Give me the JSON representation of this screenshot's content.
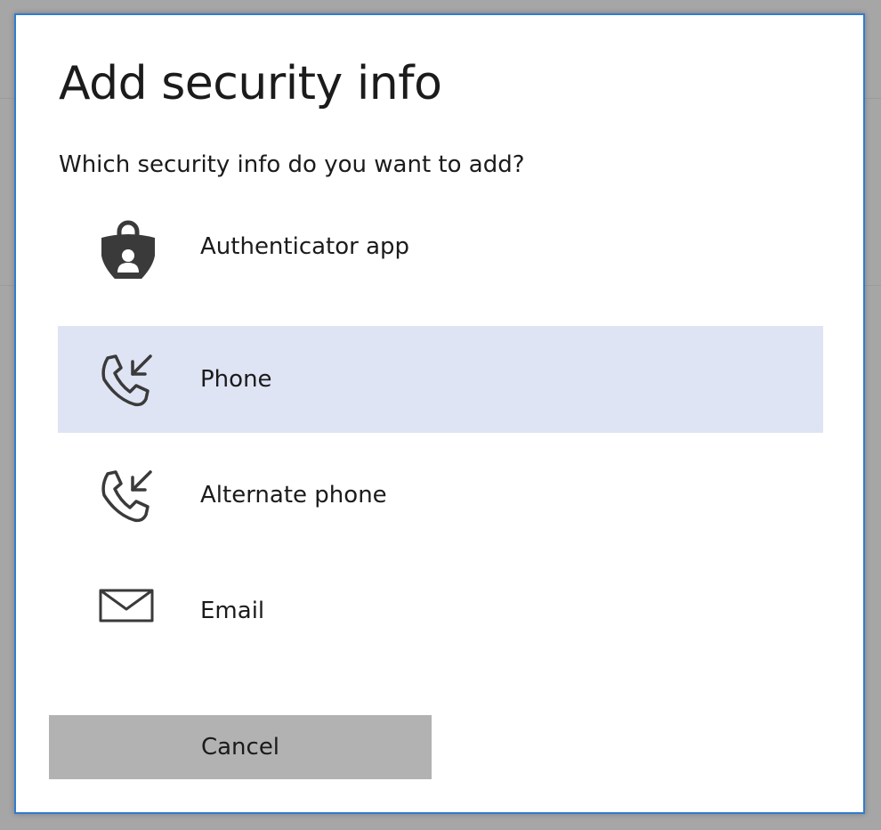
{
  "dialog": {
    "title": "Add security info",
    "prompt": "Which security info do you want to add?",
    "options": [
      {
        "label": "Authenticator app",
        "icon": "authenticator-shield-icon",
        "selected": false
      },
      {
        "label": "Phone",
        "icon": "phone-incoming-icon",
        "selected": true
      },
      {
        "label": "Alternate phone",
        "icon": "phone-incoming-icon",
        "selected": false
      },
      {
        "label": "Email",
        "icon": "envelope-icon",
        "selected": false
      }
    ],
    "cancel_label": "Cancel"
  },
  "colors": {
    "accent_border": "#2f7bd2",
    "selected_background": "#dfe4f4",
    "cancel_button_background": "#b2b2b2",
    "text": "#1b1b1b"
  }
}
